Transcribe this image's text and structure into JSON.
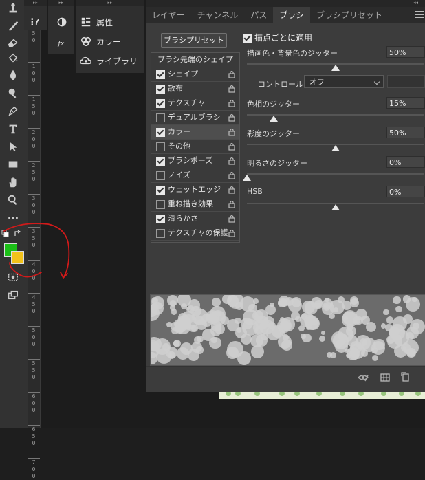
{
  "ruler": {
    "labels": [
      {
        "d1": "5",
        "d2": "0"
      },
      {
        "d1": "1",
        "d2": "0",
        "d3": "0"
      },
      {
        "d1": "1",
        "d2": "5",
        "d3": "0"
      },
      {
        "d1": "2",
        "d2": "0",
        "d3": "0"
      },
      {
        "d1": "2",
        "d2": "5",
        "d3": "0"
      },
      {
        "d1": "3",
        "d2": "0",
        "d3": "0"
      },
      {
        "d1": "3",
        "d2": "5",
        "d3": "0"
      },
      {
        "d1": "4",
        "d2": "0",
        "d3": "0"
      },
      {
        "d1": "4",
        "d2": "5",
        "d3": "0"
      },
      {
        "d1": "5",
        "d2": "0",
        "d3": "0"
      },
      {
        "d1": "5",
        "d2": "5",
        "d3": "0"
      },
      {
        "d1": "6",
        "d2": "0",
        "d3": "0"
      },
      {
        "d1": "6",
        "d2": "5",
        "d3": "0"
      },
      {
        "d1": "7",
        "d2": "0",
        "d3": "0"
      }
    ]
  },
  "dock": {
    "library": [
      {
        "label": "属性",
        "icon": "properties-icon"
      },
      {
        "label": "カラー",
        "icon": "color-icon"
      },
      {
        "label": "ライブラリ",
        "icon": "libraries-icon"
      }
    ]
  },
  "panel": {
    "tabs": [
      {
        "label": "レイヤー",
        "active": false
      },
      {
        "label": "チャンネル",
        "active": false
      },
      {
        "label": "パス",
        "active": false
      },
      {
        "label": "ブラシ",
        "active": true
      },
      {
        "label": "ブラシプリセット",
        "active": false
      }
    ],
    "preset_button": "ブラシプリセット",
    "shape_header": "ブラシ先端のシェイプ",
    "options": [
      {
        "label": "シェイプ",
        "checked": true
      },
      {
        "label": "散布",
        "checked": true
      },
      {
        "label": "テクスチャ",
        "checked": true
      },
      {
        "label": "デュアルブラシ",
        "checked": false
      },
      {
        "label": "カラー",
        "checked": true,
        "selected": true
      },
      {
        "label": "その他",
        "checked": false
      },
      {
        "label": "ブラシポーズ",
        "checked": true
      },
      {
        "label": "ノイズ",
        "checked": false
      },
      {
        "label": "ウェットエッジ",
        "checked": true
      },
      {
        "label": "重ね描き効果",
        "checked": false
      },
      {
        "label": "滑らかさ",
        "checked": true
      },
      {
        "label": "テクスチャの保護",
        "checked": false
      }
    ],
    "apply_per_tip": {
      "label": "描点ごとに適用",
      "checked": true
    },
    "fg_bg_jitter": {
      "label": "描画色・背景色のジッター",
      "value": "50%",
      "level": 0.5
    },
    "control": {
      "label": "コントロール：",
      "value": "オフ"
    },
    "hue_jitter": {
      "label": "色相のジッター",
      "value": "15%",
      "level": 0.15
    },
    "saturation_jitter": {
      "label": "彩度のジッター",
      "value": "50%",
      "level": 0.5
    },
    "brightness_jitter": {
      "label": "明るさのジッター",
      "value": "0%",
      "level": 0
    },
    "hsb": {
      "label": "HSB",
      "value": "0%",
      "level": 0.5
    }
  },
  "colors": {
    "foreground": "#1bbf17",
    "background": "#f2c21a",
    "annotation": "#d11a1a",
    "panel_bg": "#3c3c3c",
    "preview_bg": "#6b6b6b"
  }
}
